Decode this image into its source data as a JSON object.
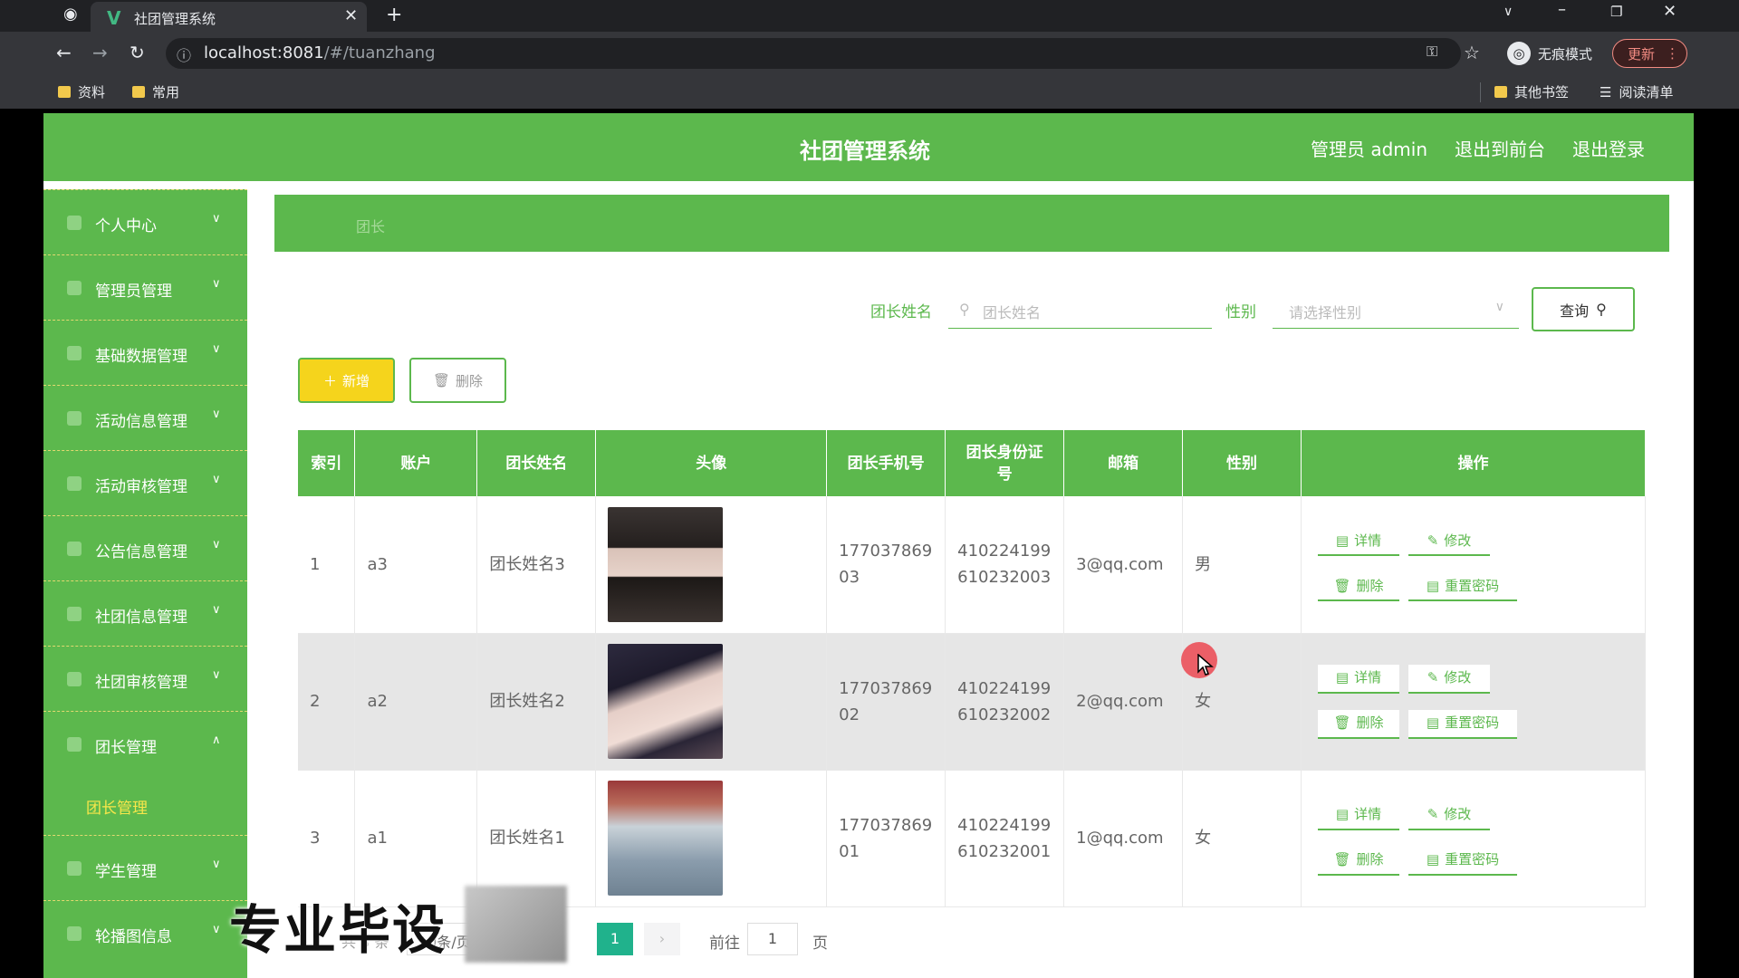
{
  "browser": {
    "tab_title": "社团管理系统",
    "url_host": "localhost:8081",
    "url_path": "/#/tuanzhang",
    "incognito_label": "无痕模式",
    "update_label": "更新",
    "bookmarks": [
      "资料",
      "常用"
    ],
    "bookmarks_right": [
      "其他书签",
      "阅读清单"
    ]
  },
  "header": {
    "title": "社团管理系统",
    "admin_label": "管理员 admin",
    "back_front": "退出到前台",
    "logout": "退出登录"
  },
  "sidebar": {
    "items": [
      {
        "label": "个人中心",
        "arrow": "∨"
      },
      {
        "label": "管理员管理",
        "arrow": "∨"
      },
      {
        "label": "基础数据管理",
        "arrow": "∨"
      },
      {
        "label": "活动信息管理",
        "arrow": "∨"
      },
      {
        "label": "活动审核管理",
        "arrow": "∨"
      },
      {
        "label": "公告信息管理",
        "arrow": "∨"
      },
      {
        "label": "社团信息管理",
        "arrow": "∨"
      },
      {
        "label": "社团审核管理",
        "arrow": "∨"
      },
      {
        "label": "团长管理",
        "arrow": "∧"
      },
      {
        "label": "学生管理",
        "arrow": "∨"
      },
      {
        "label": "轮播图信息",
        "arrow": "∨"
      }
    ],
    "active_sub": "团长管理"
  },
  "breadcrumb": "团长",
  "search": {
    "name_label": "团长姓名",
    "name_placeholder": "团长姓名",
    "gender_label": "性别",
    "gender_placeholder": "请选择性别",
    "query_label": "查询"
  },
  "actions": {
    "add_label": "新增",
    "delete_label": "删除"
  },
  "table": {
    "headers": [
      "索引",
      "账户",
      "团长姓名",
      "头像",
      "团长手机号",
      "团长身份证号",
      "邮箱",
      "性别",
      "操作"
    ],
    "ops": {
      "detail": "详情",
      "edit": "修改",
      "delete": "删除",
      "reset": "重置密码"
    },
    "rows": [
      {
        "index": "1",
        "account": "a3",
        "name": "团长姓名3",
        "phone": "17703786903",
        "id_card": "410224199610232003",
        "email": "3@qq.com",
        "gender": "男"
      },
      {
        "index": "2",
        "account": "a2",
        "name": "团长姓名2",
        "phone": "17703786902",
        "id_card": "410224199610232002",
        "email": "2@qq.com",
        "gender": "女"
      },
      {
        "index": "3",
        "account": "a1",
        "name": "团长姓名1",
        "phone": "17703786901",
        "id_card": "410224199610232001",
        "email": "1@qq.com",
        "gender": "女"
      }
    ]
  },
  "pager": {
    "goto_label": "前往",
    "page_value": "1",
    "page_suffix": "页",
    "current": "1",
    "total_text": "共 3 条",
    "size_text": "10条/页"
  },
  "watermark": "专业毕设"
}
